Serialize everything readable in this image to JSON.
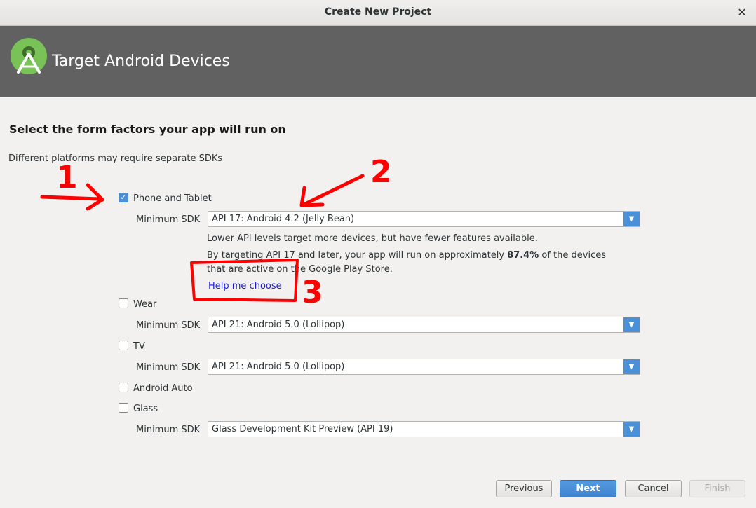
{
  "window": {
    "title": "Create New Project"
  },
  "header": {
    "title": "Target Android Devices",
    "background": "#616161",
    "logo_color": "#78c257"
  },
  "page": {
    "heading": "Select the form factors your app will run on",
    "subheading": "Different platforms may require separate SDKs"
  },
  "form_factors": {
    "phone": {
      "label": "Phone and Tablet",
      "checked": true,
      "sdk_label": "Minimum SDK",
      "sdk_value": "API 17: Android 4.2 (Jelly Bean)",
      "hint": "Lower API levels target more devices, but have fewer features available.",
      "targeting_prefix": "By targeting API 17 and later, your app will run on approximately ",
      "percentage": "87.4%",
      "targeting_suffix": " of the devices",
      "targeting_line2": "that are active on the Google Play Store.",
      "help_link": "Help me choose"
    },
    "wear": {
      "label": "Wear",
      "checked": false,
      "sdk_label": "Minimum SDK",
      "sdk_value": "API 21: Android 5.0 (Lollipop)"
    },
    "tv": {
      "label": "TV",
      "checked": false,
      "sdk_label": "Minimum SDK",
      "sdk_value": "API 21: Android 5.0 (Lollipop)"
    },
    "auto": {
      "label": "Android Auto",
      "checked": false
    },
    "glass": {
      "label": "Glass",
      "checked": false,
      "sdk_label": "Minimum SDK",
      "sdk_value": "Glass Development Kit Preview (API 19)"
    }
  },
  "buttons": {
    "previous": "Previous",
    "next": "Next",
    "cancel": "Cancel",
    "finish": "Finish"
  },
  "annotations": {
    "one": "1",
    "two": "2",
    "three": "3",
    "color": "#ff0000"
  }
}
